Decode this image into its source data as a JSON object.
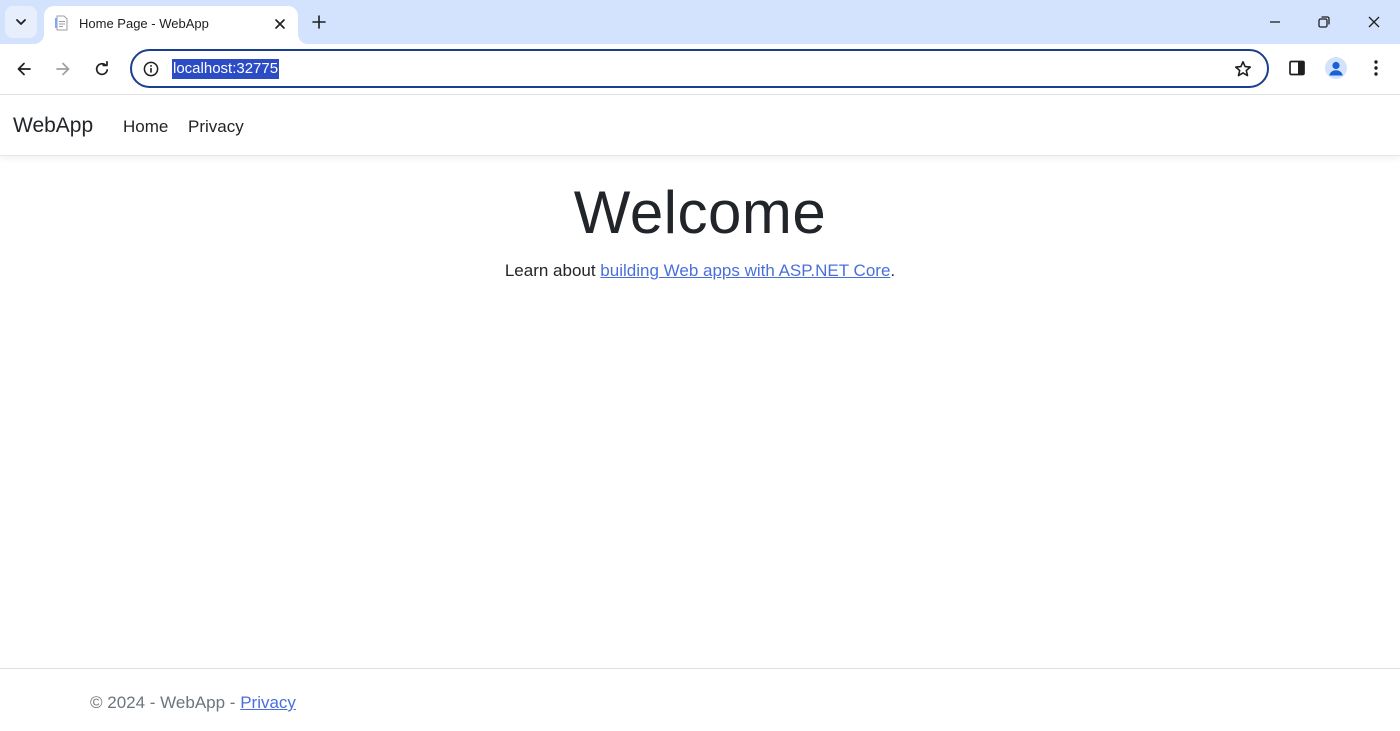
{
  "browser": {
    "tab": {
      "title": "Home Page - WebApp"
    },
    "address_bar": {
      "url": "localhost:32775"
    }
  },
  "page": {
    "navbar": {
      "brand": "WebApp",
      "links": [
        {
          "label": "Home"
        },
        {
          "label": "Privacy"
        }
      ]
    },
    "main": {
      "heading": "Welcome",
      "learn_prefix": "Learn about ",
      "learn_link": "building Web apps with ASP.NET Core",
      "learn_suffix": "."
    },
    "footer": {
      "text": "© 2024 - WebApp - ",
      "privacy_link": "Privacy"
    }
  },
  "icons": {
    "tab_search": "chevron-down-icon",
    "favicon": "page-icon",
    "close_tab": "close-icon",
    "new_tab": "plus-icon",
    "back": "arrow-left-icon",
    "forward": "arrow-right-icon",
    "reload": "reload-icon",
    "site_info": "info-icon",
    "bookmark": "star-icon",
    "side_panel": "side-panel-icon",
    "profile": "person-icon",
    "menu": "kebab-menu-icon"
  },
  "colors": {
    "tabstrip": "#d3e3fd",
    "omnibox_border": "#1a3f8e",
    "url_selection": "#2b4cc4",
    "link": "#4a6fdd",
    "text": "#212529",
    "muted_text": "#6c757d"
  }
}
